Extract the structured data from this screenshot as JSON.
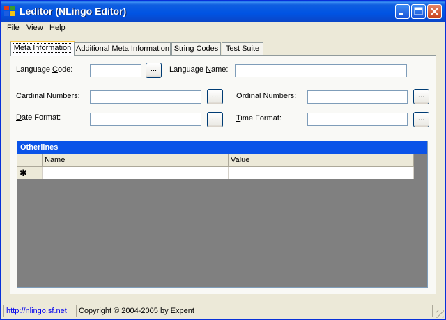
{
  "window": {
    "title": "Leditor (NLingo Editor)"
  },
  "menu": [
    {
      "accel": "F",
      "rest": "ile"
    },
    {
      "accel": "V",
      "rest": "iew"
    },
    {
      "accel": "H",
      "rest": "elp"
    }
  ],
  "tabs": [
    {
      "label": "Meta Information",
      "active": true
    },
    {
      "label": "Additional Meta Information",
      "active": false
    },
    {
      "label": "String Codes",
      "active": false
    },
    {
      "label": "Test Suite",
      "active": false
    }
  ],
  "form": {
    "language_code": {
      "pre": "Language ",
      "accel": "C",
      "post": "ode:",
      "value": ""
    },
    "language_name": {
      "pre": "Language ",
      "accel": "N",
      "post": "ame:",
      "value": ""
    },
    "cardinal_numbers": {
      "pre": "",
      "accel": "C",
      "post": "ardinal Numbers:",
      "value": ""
    },
    "ordinal_numbers": {
      "pre": "",
      "accel": "O",
      "post": "rdinal Numbers:",
      "value": ""
    },
    "date_format": {
      "pre": "",
      "accel": "D",
      "post": "ate Format:",
      "value": ""
    },
    "time_format": {
      "pre": "",
      "accel": "T",
      "post": "ime Format:",
      "value": ""
    },
    "browse_label": "..."
  },
  "grid": {
    "caption": "Otherlines",
    "columns": [
      "Name",
      "Value"
    ],
    "new_row_marker": "✱"
  },
  "status": {
    "link": "http://nlingo.sf.net",
    "copyright": "Copyright © 2004-2005 by Expent"
  },
  "colors": {
    "titlebar": "#0054e3",
    "grid_caption": "#0a53e8",
    "grid_background": "#808080",
    "link": "#0000ee"
  }
}
